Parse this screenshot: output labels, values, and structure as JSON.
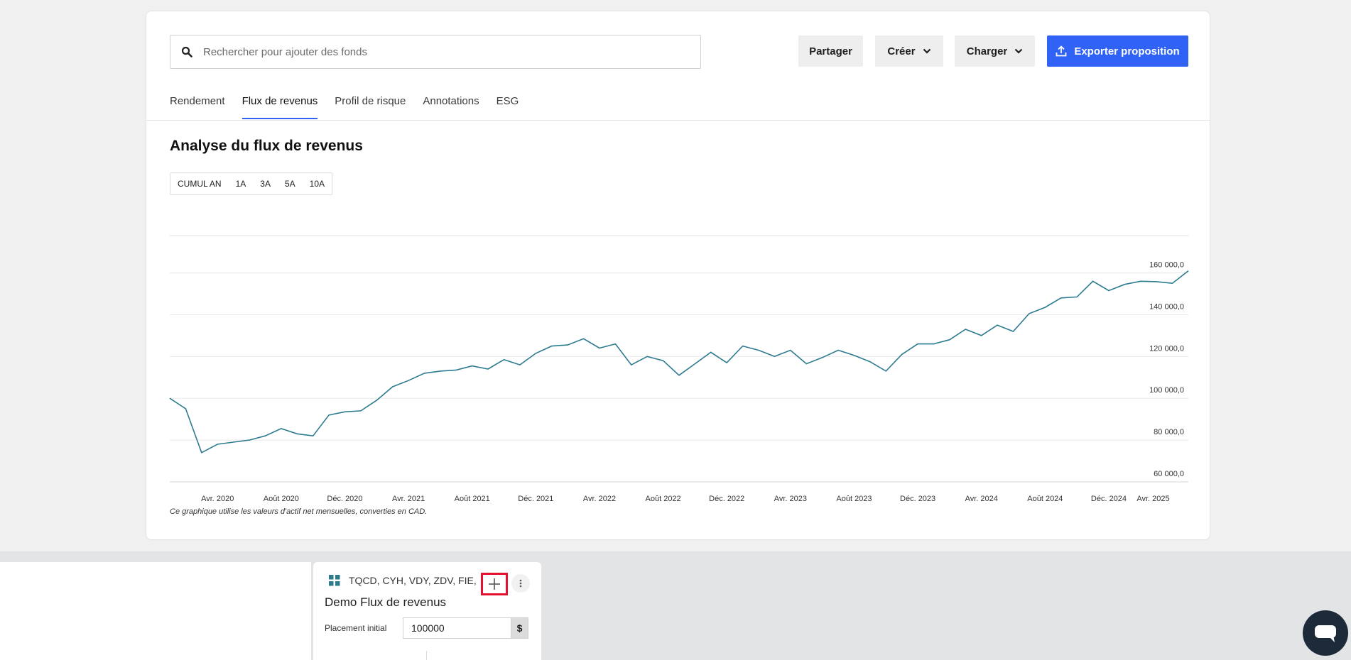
{
  "toolbar": {
    "search_placeholder": "Rechercher pour ajouter des fonds",
    "share_label": "Partager",
    "create_label": "Créer",
    "load_label": "Charger",
    "export_label": "Exporter proposition"
  },
  "tabs": [
    {
      "label": "Rendement",
      "active": false
    },
    {
      "label": "Flux de revenus",
      "active": true
    },
    {
      "label": "Profil de risque",
      "active": false
    },
    {
      "label": "Annotations",
      "active": false
    },
    {
      "label": "ESG",
      "active": false
    }
  ],
  "section_title": "Analyse du flux de revenus",
  "ranges": [
    "CUMUL AN",
    "1A",
    "3A",
    "5A",
    "10A"
  ],
  "chart_note": "Ce graphique utilise les valeurs d'actif net mensuelles, converties en CAD.",
  "colors": {
    "accent": "#2f62f5",
    "line": "#2e7b90",
    "highlight": "#e5102e"
  },
  "chart_data": {
    "type": "line",
    "title": "",
    "xlabel": "",
    "ylabel": "",
    "ylim": [
      60000,
      170000
    ],
    "y_ticks": [
      60000,
      80000,
      100000,
      120000,
      140000,
      160000
    ],
    "y_tick_labels": [
      "60 000,0",
      "80 000,0",
      "100 000,0",
      "120 000,0",
      "140 000,0",
      "160 000,0"
    ],
    "x_tick_labels": [
      "Avr. 2020",
      "Août 2020",
      "Déc. 2020",
      "Avr. 2021",
      "Août 2021",
      "Déc. 2021",
      "Avr. 2022",
      "Août 2022",
      "Déc. 2022",
      "Avr. 2023",
      "Août 2023",
      "Déc. 2023",
      "Avr. 2024",
      "Août 2024",
      "Déc. 2024",
      "Avr. 2025"
    ],
    "x_start": "2020-01",
    "x_end": "2025-05",
    "grid": true,
    "series": [
      {
        "values": [
          100000,
          95000,
          74000,
          78000,
          79000,
          80000,
          82000,
          85500,
          83000,
          82000,
          92000,
          93500,
          94000,
          99000,
          105500,
          108500,
          112000,
          113000,
          113500,
          115500,
          114000,
          118500,
          116000,
          121500,
          125000,
          125500,
          128500,
          124000,
          126000,
          116000,
          120000,
          118000,
          111000,
          116500,
          122000,
          117000,
          125000,
          123000,
          120000,
          123000,
          116500,
          119500,
          123000,
          120500,
          117500,
          113000,
          121000,
          126000,
          126000,
          128000,
          133000,
          130000,
          135000,
          132000,
          140500,
          143500,
          148000,
          148500,
          156000,
          151500,
          154500,
          156000,
          155800,
          155000,
          161000
        ]
      }
    ]
  },
  "portfolio": {
    "tickers": "TQCD, CYH, VDY, ZDV, FIE,",
    "name": "Demo Flux de revenus",
    "initial_label": "Placement initial",
    "initial_value": "100000",
    "currency": "$"
  }
}
